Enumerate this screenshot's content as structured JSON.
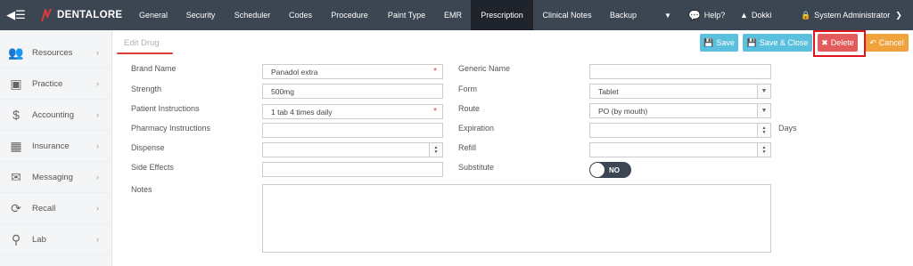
{
  "app": {
    "brand": "DENTALORE"
  },
  "colors": {
    "topbar": "#3c4552",
    "accent": "#5bc0de",
    "danger": "#e35b5b",
    "warning": "#f0a33c",
    "highlight": "#e0141f"
  },
  "nav": {
    "items": [
      "General",
      "Security",
      "Scheduler",
      "Codes",
      "Procedure",
      "Paint Type",
      "EMR",
      "Prescription",
      "Clinical Notes",
      "Backup"
    ],
    "active": "Prescription",
    "help": "Help?",
    "user": "Dokki",
    "role": "System Administrator"
  },
  "sidebar": {
    "items": [
      {
        "label": "Resources",
        "icon": "users-icon"
      },
      {
        "label": "Practice",
        "icon": "medkit-icon"
      },
      {
        "label": "Accounting",
        "icon": "dollar-icon"
      },
      {
        "label": "Insurance",
        "icon": "building-icon"
      },
      {
        "label": "Messaging",
        "icon": "envelope-icon"
      },
      {
        "label": "Recall",
        "icon": "refresh-icon"
      },
      {
        "label": "Lab",
        "icon": "flask-icon"
      }
    ]
  },
  "page": {
    "title": "Edit Drug"
  },
  "actions": {
    "save": "Save",
    "save_close": "Save & Close",
    "delete": "Delete",
    "cancel": "Cancel"
  },
  "form": {
    "brand_name": {
      "label": "Brand Name",
      "value": "Panadol extra"
    },
    "generic_name": {
      "label": "Generic Name",
      "value": ""
    },
    "strength": {
      "label": "Strength",
      "value": "500mg"
    },
    "form": {
      "label": "Form",
      "value": "Tablet"
    },
    "patient_instructions": {
      "label": "Patient Instructions",
      "value": "1 tab 4 times daily"
    },
    "route": {
      "label": "Route",
      "value": "PO (by mouth)"
    },
    "pharmacy_instructions": {
      "label": "Pharmacy Instructions",
      "value": ""
    },
    "expiration": {
      "label": "Expiration",
      "value": "",
      "unit": "Days"
    },
    "dispense": {
      "label": "Dispense",
      "value": ""
    },
    "refill": {
      "label": "Refill",
      "value": ""
    },
    "side_effects": {
      "label": "Side Effects",
      "value": ""
    },
    "substitute": {
      "label": "Substitute",
      "value": "NO"
    },
    "notes": {
      "label": "Notes",
      "value": ""
    }
  }
}
